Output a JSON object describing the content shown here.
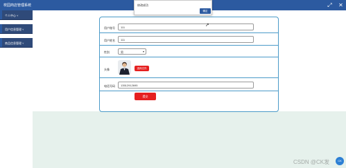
{
  "app": {
    "title": "校园商店管理系统"
  },
  "topbar": {
    "icons": [
      "expand-icon",
      "close-icon"
    ]
  },
  "sidebar": {
    "items": [
      {
        "label": "个人中心"
      },
      {
        "label": "用户信息管理"
      },
      {
        "label": "商品信息管理"
      }
    ]
  },
  "form": {
    "account": {
      "label": "用户账号",
      "value": "111"
    },
    "name": {
      "label": "用户姓名",
      "value": "111"
    },
    "gender": {
      "label": "性别",
      "value": "男"
    },
    "avatar": {
      "label": "头像",
      "upload_label": "选择文件"
    },
    "phone": {
      "label": "电话号码",
      "value": "13512912695"
    },
    "submit_label": "提交"
  },
  "modal": {
    "message": "修改成功",
    "ok_label": "确定"
  },
  "watermark": {
    "text": "CSDN @CK发"
  },
  "badge": {
    "text": "CK"
  },
  "colors": {
    "topbar": "#2c5aa0",
    "sidebar": "#2f4a79",
    "accent_red": "#e52020",
    "border_blue": "#4a9ac8",
    "bottom_bg": "#e6f1ec"
  }
}
